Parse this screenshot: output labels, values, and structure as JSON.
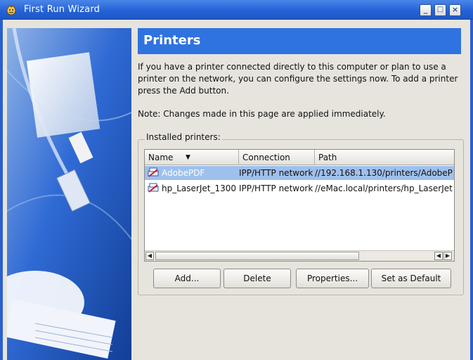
{
  "window": {
    "title": "First Run Wizard",
    "controls": [
      "_",
      "□",
      "×"
    ]
  },
  "page": {
    "heading": "Printers",
    "intro": "If you have a printer connected directly to this computer or plan to use a printer on the network, you can configure the settings now. To add a printer press the Add button.",
    "note": "Note: Changes made in this page are applied immediately."
  },
  "printers": {
    "group_label": "Installed printers:",
    "columns": [
      "Name",
      "Connection",
      "Path"
    ],
    "rows": [
      {
        "name": "AdobePDF",
        "connection": "IPP/HTTP network",
        "path": "//192.168.1.130/printers/AdobeP",
        "selected": true
      },
      {
        "name": "hp_LaserJet_1300",
        "connection": "IPP/HTTP network",
        "path": "//eMac.local/printers/hp_LaserJet",
        "selected": false
      }
    ]
  },
  "buttons": {
    "add": "Add...",
    "delete": "Delete",
    "properties": "Properties...",
    "set_default": "Set as Default"
  },
  "colors": {
    "titlebar": "#2563d8",
    "header": "#2f73e0",
    "selection": "#9fc0ec"
  }
}
